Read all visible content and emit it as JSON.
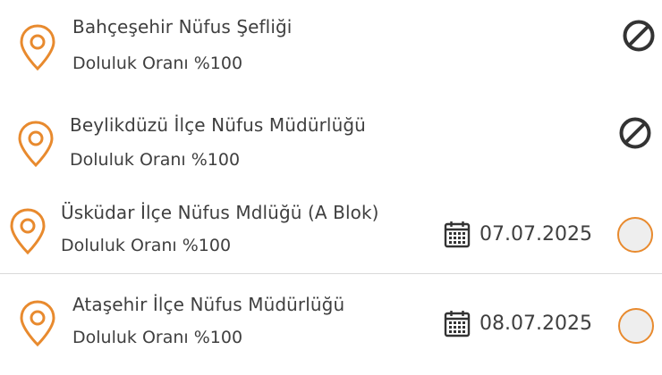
{
  "colors": {
    "accent": "#e88a2e",
    "text": "#3f3f3f",
    "radio_fill": "#eeeeee",
    "divider": "#d9d9d9"
  },
  "items": [
    {
      "name": "Bahçeşehir Nüfus Şefliği",
      "occupancy": "Doluluk Oranı %100",
      "status_icon": "blocked-icon"
    },
    {
      "name": "Beylikdüzü İlçe Nüfus Müdürlüğü",
      "occupancy": "Doluluk Oranı %100",
      "status_icon": "blocked-icon"
    },
    {
      "name": "Üsküdar İlçe Nüfus Mdlüğü (A Blok)",
      "occupancy": "Doluluk Oranı %100",
      "date": "07.07.2025",
      "status_icon": "radio-unselected"
    },
    {
      "name": "Ataşehir İlçe Nüfus Müdürlüğü",
      "occupancy": "Doluluk Oranı %100",
      "date": "08.07.2025",
      "status_icon": "radio-unselected"
    }
  ]
}
